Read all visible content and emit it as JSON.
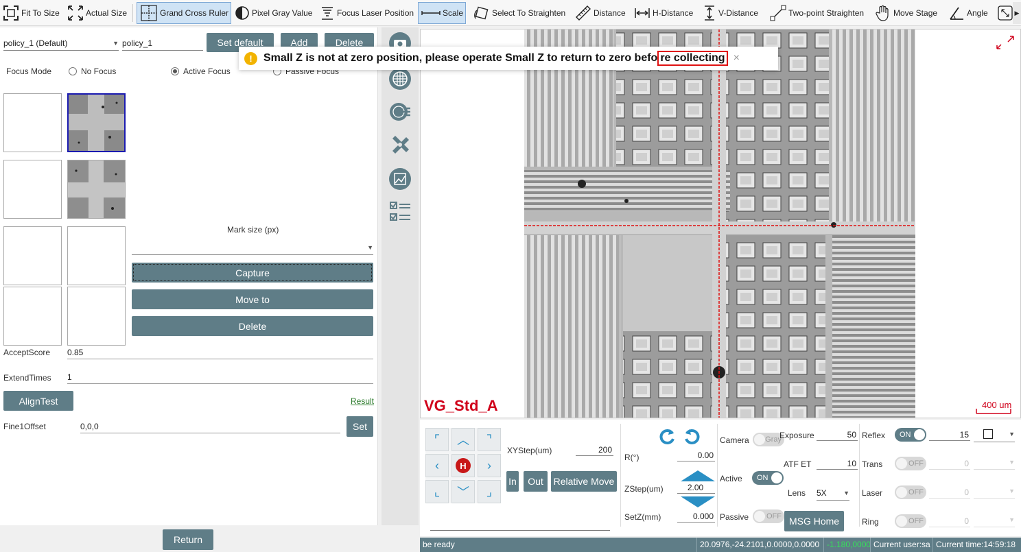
{
  "toolbar": {
    "fit_to_size": "Fit To Size",
    "actual_size": "Actual Size",
    "grand_cross_ruler": "Grand Cross Ruler",
    "pixel_gray_value": "Pixel Gray Value",
    "focus_laser_position": "Focus Laser Position",
    "scale": "Scale",
    "select_to_straighten": "Select To Straighten",
    "distance": "Distance",
    "h_distance": "H-Distance",
    "v_distance": "V-Distance",
    "two_point_straighten": "Two-point Straighten",
    "move_stage": "Move Stage",
    "angle": "Angle"
  },
  "left": {
    "policy_select": "policy_1 (Default)",
    "policy_name": "policy_1",
    "set_default": "Set default",
    "add": "Add",
    "delete_top": "Delete",
    "focus_mode_label": "Focus Mode",
    "no_focus": "No Focus",
    "active_focus": "Active Focus",
    "passive_focus": "Passive Focus",
    "mark_size_label": "Mark size (px)",
    "capture": "Capture",
    "move_to": "Move to",
    "delete": "Delete",
    "accept_score_label": "AcceptScore",
    "accept_score": "0.85",
    "extend_times_label": "ExtendTimes",
    "extend_times": "1",
    "align_test": "AlignTest",
    "result_link": "Result",
    "fine1_offset_label": "Fine1Offset",
    "fine1_offset": "0,0,0",
    "set": "Set",
    "return": "Return"
  },
  "toast": {
    "message_before": "Small Z is not at zero position, please operate Small Z to return to zero befo",
    "message_highlight": "re collecting"
  },
  "viewer": {
    "sample_label": "VG_Std_A",
    "scale_bar": "400 um"
  },
  "controls": {
    "xystep_label": "XYStep(um)",
    "xystep": "200",
    "home_label": "H",
    "in": "In",
    "out": "Out",
    "relative_move": "Relative Move",
    "r_label": "R(°)",
    "r_value": "0.00",
    "zstep_label": "ZStep(um)",
    "zstep": "2.00",
    "setz_label": "SetZ(mm)",
    "setz": "0.000",
    "camera_label": "Camera",
    "camera_toggle": "Gray",
    "active_label": "Active",
    "active_toggle": "ON",
    "passive_label": "Passive",
    "passive_toggle": "OFF",
    "exposure_label": "Exposure",
    "exposure": "50",
    "atf_label": "ATF ET",
    "atf": "10",
    "lens_label": "Lens",
    "lens": "5X",
    "msg_home": "MSG Home",
    "reflex_label": "Reflex",
    "reflex_toggle": "ON",
    "reflex_value": "15",
    "trans_label": "Trans",
    "trans_toggle": "OFF",
    "trans_value": "0",
    "laser_label": "Laser",
    "laser_toggle": "OFF",
    "laser_value": "0",
    "ring_label": "Ring",
    "ring_toggle": "OFF",
    "ring_value": "0"
  },
  "status": {
    "message": "be ready",
    "coords": "20.0976,-24.2101,0.0000,0.0000",
    "z_value": "-1.180,0000",
    "user": "Current user:sa",
    "time": "Current time:14:59:18"
  },
  "colors": {
    "accent": "#5f7d87",
    "warning_red": "#d0021b",
    "icon_blue": "#2a8fc4"
  }
}
